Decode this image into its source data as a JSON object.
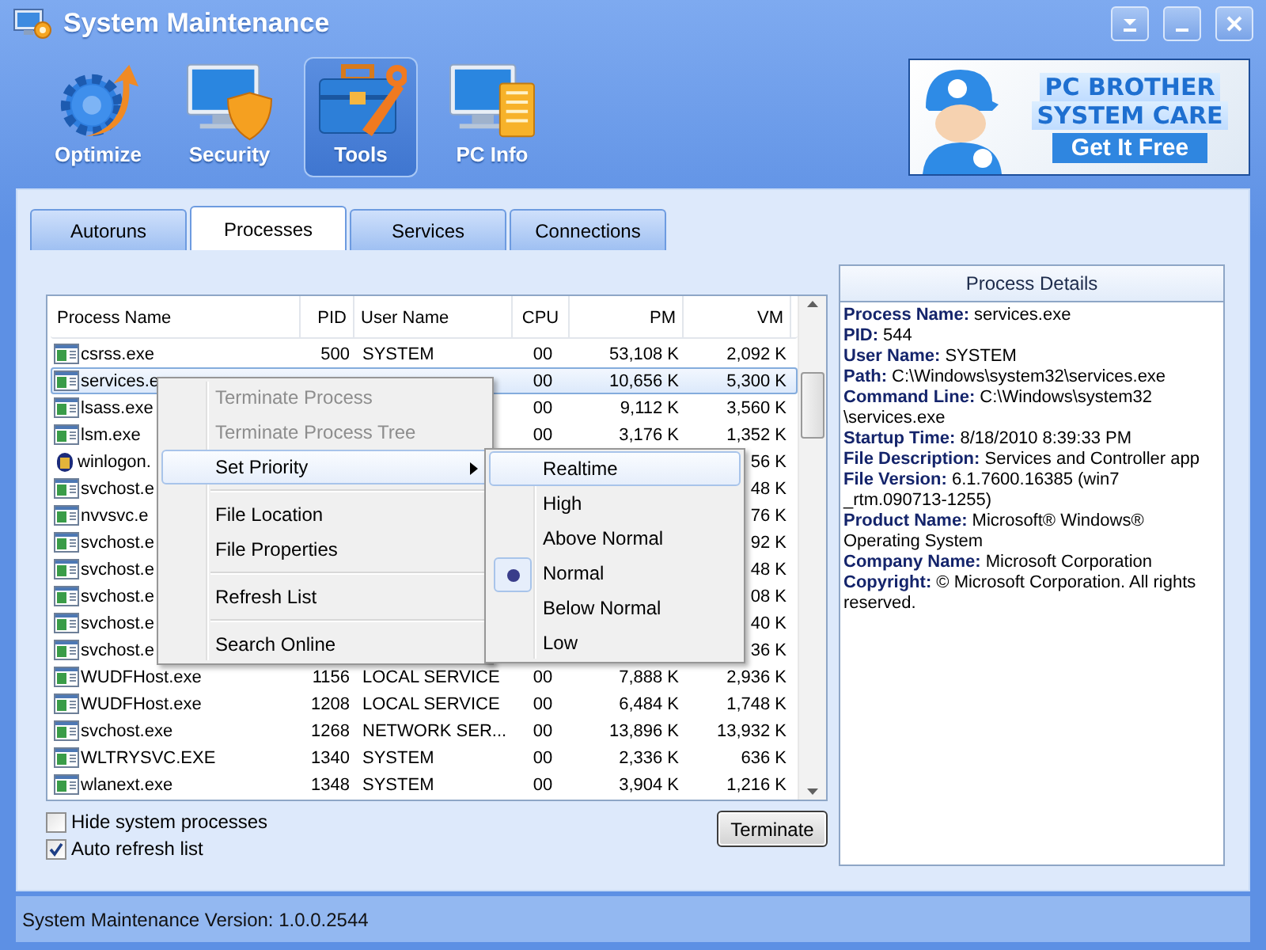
{
  "window": {
    "title": "System Maintenance"
  },
  "toolbar": [
    {
      "label": "Optimize",
      "kind": "optimize",
      "selected": false
    },
    {
      "label": "Security",
      "kind": "security",
      "selected": false
    },
    {
      "label": "Tools",
      "kind": "tools",
      "selected": true
    },
    {
      "label": "PC Info",
      "kind": "info",
      "selected": false
    }
  ],
  "banner": {
    "line_1": "PC BROTHER",
    "line_2": "SYSTEM CARE",
    "call_to_action": "Get It Free"
  },
  "tabs": [
    {
      "label": "Autoruns",
      "selected": false
    },
    {
      "label": "Processes",
      "selected": true
    },
    {
      "label": "Services",
      "selected": false
    },
    {
      "label": "Connections",
      "selected": false
    }
  ],
  "table": {
    "columns": [
      "Process Name",
      "PID",
      "User Name",
      "CPU",
      "PM",
      "VM"
    ],
    "rows": [
      {
        "kind": "app",
        "selected": false,
        "cells": [
          "csrss.exe",
          "500",
          "SYSTEM",
          "00",
          "53,108 K",
          "2,092 K"
        ]
      },
      {
        "kind": "app",
        "selected": true,
        "cells": [
          "services.e",
          null,
          null,
          "00",
          "10,656 K",
          "5,300 K"
        ]
      },
      {
        "kind": "app",
        "selected": false,
        "cells": [
          "lsass.exe",
          null,
          null,
          "00",
          "9,112 K",
          "3,560 K"
        ]
      },
      {
        "kind": "app",
        "selected": false,
        "cells": [
          "lsm.exe",
          null,
          null,
          "00",
          "3,176 K",
          "1,352 K"
        ]
      },
      {
        "kind": "system",
        "selected": false,
        "cells": [
          "winlogon.",
          null,
          null,
          null,
          null,
          "56 K"
        ]
      },
      {
        "kind": "app",
        "selected": false,
        "cells": [
          "svchost.e",
          null,
          null,
          null,
          null,
          "48 K"
        ]
      },
      {
        "kind": "app",
        "selected": false,
        "cells": [
          "nvvsvc.e",
          null,
          null,
          null,
          null,
          "76 K"
        ]
      },
      {
        "kind": "app",
        "selected": false,
        "cells": [
          "svchost.e",
          null,
          null,
          null,
          null,
          "92 K"
        ]
      },
      {
        "kind": "app",
        "selected": false,
        "cells": [
          "svchost.e",
          null,
          null,
          null,
          null,
          "48 K"
        ]
      },
      {
        "kind": "app",
        "selected": false,
        "cells": [
          "svchost.e",
          null,
          null,
          null,
          null,
          "08 K"
        ]
      },
      {
        "kind": "app",
        "selected": false,
        "cells": [
          "svchost.e",
          null,
          null,
          null,
          null,
          "40 K"
        ]
      },
      {
        "kind": "app",
        "selected": false,
        "cells": [
          "svchost.e",
          null,
          null,
          null,
          null,
          "36 K"
        ]
      },
      {
        "kind": "app",
        "selected": false,
        "cells": [
          "WUDFHost.exe",
          "1156",
          "LOCAL SERVICE",
          "00",
          "7,888 K",
          "2,936 K"
        ]
      },
      {
        "kind": "app",
        "selected": false,
        "cells": [
          "WUDFHost.exe",
          "1208",
          "LOCAL SERVICE",
          "00",
          "6,484 K",
          "1,748 K"
        ]
      },
      {
        "kind": "app",
        "selected": false,
        "cells": [
          "svchost.exe",
          "1268",
          "NETWORK SER...",
          "00",
          "13,896 K",
          "13,932 K"
        ]
      },
      {
        "kind": "app",
        "selected": false,
        "cells": [
          "WLTRYSVC.EXE",
          "1340",
          "SYSTEM",
          "00",
          "2,336 K",
          "636 K"
        ]
      },
      {
        "kind": "app",
        "selected": false,
        "cells": [
          "wlanext.exe",
          "1348",
          "SYSTEM",
          "00",
          "3,904 K",
          "1,216 K"
        ]
      }
    ]
  },
  "options": [
    {
      "label": "Hide system processes",
      "checked": false
    },
    {
      "label": "Auto refresh list",
      "checked": true
    }
  ],
  "terminate_button": "Terminate",
  "details": {
    "title": "Process Details",
    "lines": [
      "**Process Name:** services.exe",
      "**PID:** 544",
      "**User Name:** SYSTEM",
      "**Path:** C:\\Windows\\system32\\services.exe",
      "**Command Line:** C:\\Windows\\system32 \\services.exe",
      "**Startup Time:** 8/18/2010 8:39:33 PM",
      "**File Description:** Services and Controller app",
      "**File Version:** 6.1.7600.16385 (win7 _rtm.090713-1255)",
      "**Product Name:** Microsoft® Windows® Operating System",
      "**Company Name:** Microsoft Corporation",
      "**Copyright:** © Microsoft Corporation. All rights reserved."
    ]
  },
  "context_menu": {
    "groups": [
      [
        {
          "label": "Terminate Process",
          "disabled": true,
          "highlighted": false
        },
        {
          "label": "Terminate Process Tree",
          "disabled": true,
          "highlighted": false
        },
        {
          "label": "Set Priority",
          "disabled": false,
          "highlighted": true,
          "submenu": [
            {
              "label": "Realtime",
              "selected": false,
              "highlighted": true
            },
            {
              "label": "High",
              "selected": false,
              "highlighted": false
            },
            {
              "label": "Above Normal",
              "selected": false,
              "highlighted": false
            },
            {
              "label": "Normal",
              "selected": true,
              "highlighted": false
            },
            {
              "label": "Below Normal",
              "selected": false,
              "highlighted": false
            },
            {
              "label": "Low",
              "selected": false,
              "highlighted": false
            }
          ]
        }
      ],
      [
        {
          "label": "File Location",
          "disabled": false,
          "highlighted": false
        },
        {
          "label": "File Properties",
          "disabled": false,
          "highlighted": false
        }
      ],
      [
        {
          "label": "Refresh List",
          "disabled": false,
          "highlighted": false
        }
      ],
      [
        {
          "label": "Search Online",
          "disabled": false,
          "highlighted": false
        }
      ]
    ]
  },
  "status_bar": "System Maintenance Version: 1.0.0.2544"
}
